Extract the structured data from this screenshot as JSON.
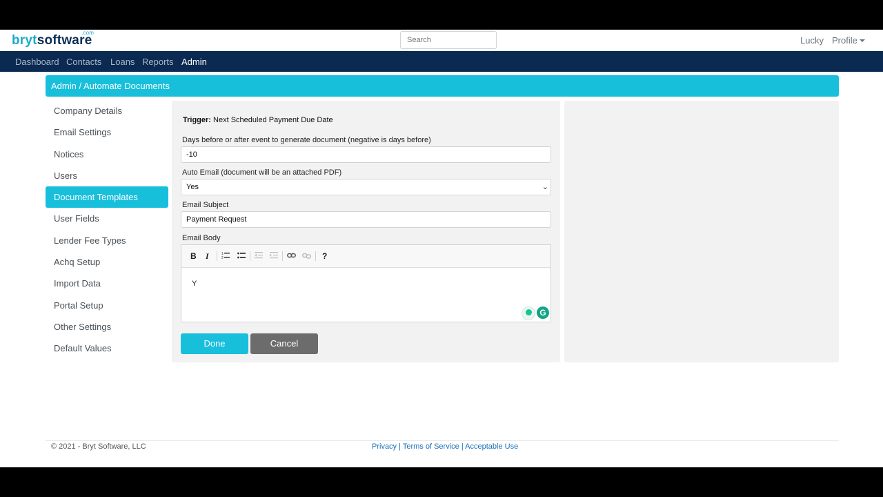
{
  "header": {
    "logo_part1": "bryt",
    "logo_part2": "software",
    "logo_com": ".com",
    "search_placeholder": "Search",
    "user_name": "Lucky",
    "profile_label": "Profile"
  },
  "nav": {
    "items": [
      "Dashboard",
      "Contacts",
      "Loans",
      "Reports",
      "Admin"
    ],
    "active": "Admin"
  },
  "breadcrumb": "Admin / Automate Documents",
  "sidebar": {
    "items": [
      "Company Details",
      "Email Settings",
      "Notices",
      "Users",
      "Document Templates",
      "User Fields",
      "Lender Fee Types",
      "Achq Setup",
      "Import Data",
      "Portal Setup",
      "Other Settings",
      "Default Values"
    ],
    "active": "Document Templates"
  },
  "form": {
    "trigger_label": "Trigger:",
    "trigger_value": "Next Scheduled Payment Due Date",
    "days_label": "Days before or after event to generate document (negative is days before)",
    "days_value": "-10",
    "auto_email_label": "Auto Email (document will be an attached PDF)",
    "auto_email_value": "Yes",
    "subject_label": "Email Subject",
    "subject_value": "Payment Request",
    "body_label": "Email Body",
    "body_value": "Y",
    "done_label": "Done",
    "cancel_label": "Cancel"
  },
  "editor_toolbar": [
    "bold-icon",
    "italic-icon",
    "ordered-list-icon",
    "unordered-list-icon",
    "outdent-icon",
    "indent-icon",
    "link-icon",
    "unlink-icon",
    "help-icon"
  ],
  "footer": {
    "copyright": "© 2021 - Bryt Software, LLC",
    "privacy": "Privacy",
    "terms": "Terms of Service",
    "acceptable": "Acceptable Use",
    "separator": " | "
  },
  "colors": {
    "accent": "#17bfdb",
    "navbar": "#0b2a52",
    "cancel": "#6c6c6c"
  }
}
